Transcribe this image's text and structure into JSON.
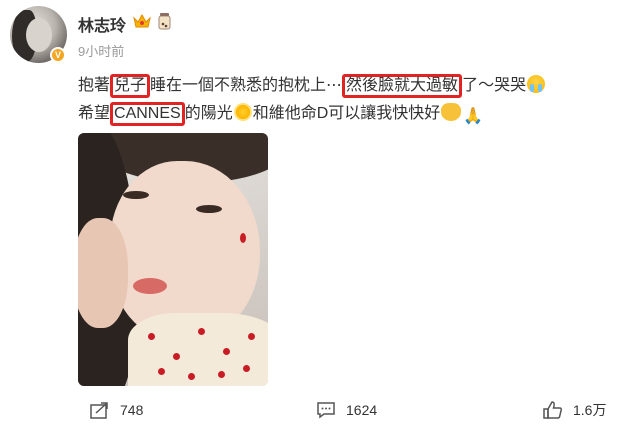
{
  "user": {
    "name": "林志玲",
    "timestamp": "9小时前"
  },
  "post": {
    "line1": {
      "part1": "抱著",
      "boxed1": "兒子",
      "part2": "睡在一個不熟悉的抱枕上⋯",
      "boxed2": "然後臉就大過敏",
      "part3": "了～哭哭"
    },
    "line2": {
      "part1": "希望",
      "boxed1": "CANNES",
      "part2": "的陽光",
      "part3": "和維他命D可以讓我快快好"
    },
    "emojis": [
      "crying-face-icon",
      "sun-icon",
      "open-hands-icon",
      "praying-hands-icon"
    ]
  },
  "actions": {
    "share_count": "748",
    "comment_count": "1624",
    "like_count": "1.6万"
  },
  "colors": {
    "highlight_box": "#e02424",
    "text": "#333333",
    "muted": "#999999",
    "verified_badge": "#f5a623"
  }
}
